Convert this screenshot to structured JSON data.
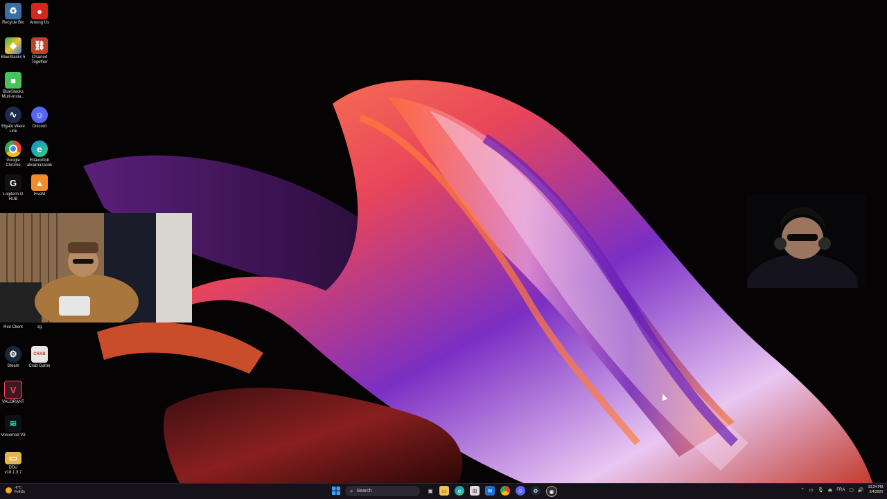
{
  "desktop": {
    "icons": [
      {
        "label": "Recycle Bin",
        "icon": "recycle-bin-icon",
        "color": "#3a6ea5"
      },
      {
        "label": "Among Us",
        "icon": "among-us-icon",
        "color": "#d4281f"
      },
      {
        "label": "BlueStacks 5",
        "icon": "bluestacks-icon",
        "color": "#2db34a"
      },
      {
        "label": "Chained Together",
        "icon": "chained-together-icon",
        "color": "#b8452a"
      },
      {
        "label": "BlueStacks Multi-Insta...",
        "icon": "bluestacks-multi-icon",
        "color": "#46c25a"
      },
      {
        "label": "Elgato Wave Link",
        "icon": "elgato-wave-link-icon",
        "color": "#1d2a4a"
      },
      {
        "label": "Discord",
        "icon": "discord-icon",
        "color": "#5865f2"
      },
      {
        "label": "Google Chrome",
        "icon": "chrome-icon",
        "color": "#ea4335"
      },
      {
        "label": "Eltávolított alkalmazások",
        "icon": "edge-icon",
        "color": "#0c8bd6"
      },
      {
        "label": "Logitech G HUB",
        "icon": "logitech-icon",
        "color": "#111111"
      },
      {
        "label": "FiveM",
        "icon": "fivem-icon",
        "color": "#f28c28"
      },
      {
        "label": "Riot Client",
        "icon": "riot-client-icon",
        "color": "#d13639"
      },
      {
        "label": "zg",
        "icon": "zg-icon",
        "color": "#dddddd"
      },
      {
        "label": "Steam",
        "icon": "steam-icon",
        "color": "#1b2838"
      },
      {
        "label": "Crab Game",
        "icon": "crab-game-icon",
        "color": "#e6e6e6"
      },
      {
        "label": "VALORANT",
        "icon": "valorant-icon",
        "color": "#fa4454"
      },
      {
        "label": "Voicemod V3",
        "icon": "voicemod-icon",
        "color": "#0d1117"
      },
      {
        "label": "DDU v18.1.3.7",
        "icon": "ddu-folder-icon",
        "color": "#e6b64c"
      }
    ]
  },
  "taskbar": {
    "weather_temp": "-6°C",
    "weather_desc": "Felhős",
    "search_placeholder": "Search",
    "apps": [
      "task-view-icon",
      "file-explorer-icon",
      "edge-icon",
      "store-icon",
      "mail-icon",
      "chrome-icon",
      "discord-icon",
      "steam-icon",
      "obs-icon"
    ],
    "lang": "FRA",
    "time": "10:24 PM",
    "date": "2/4/2026"
  }
}
